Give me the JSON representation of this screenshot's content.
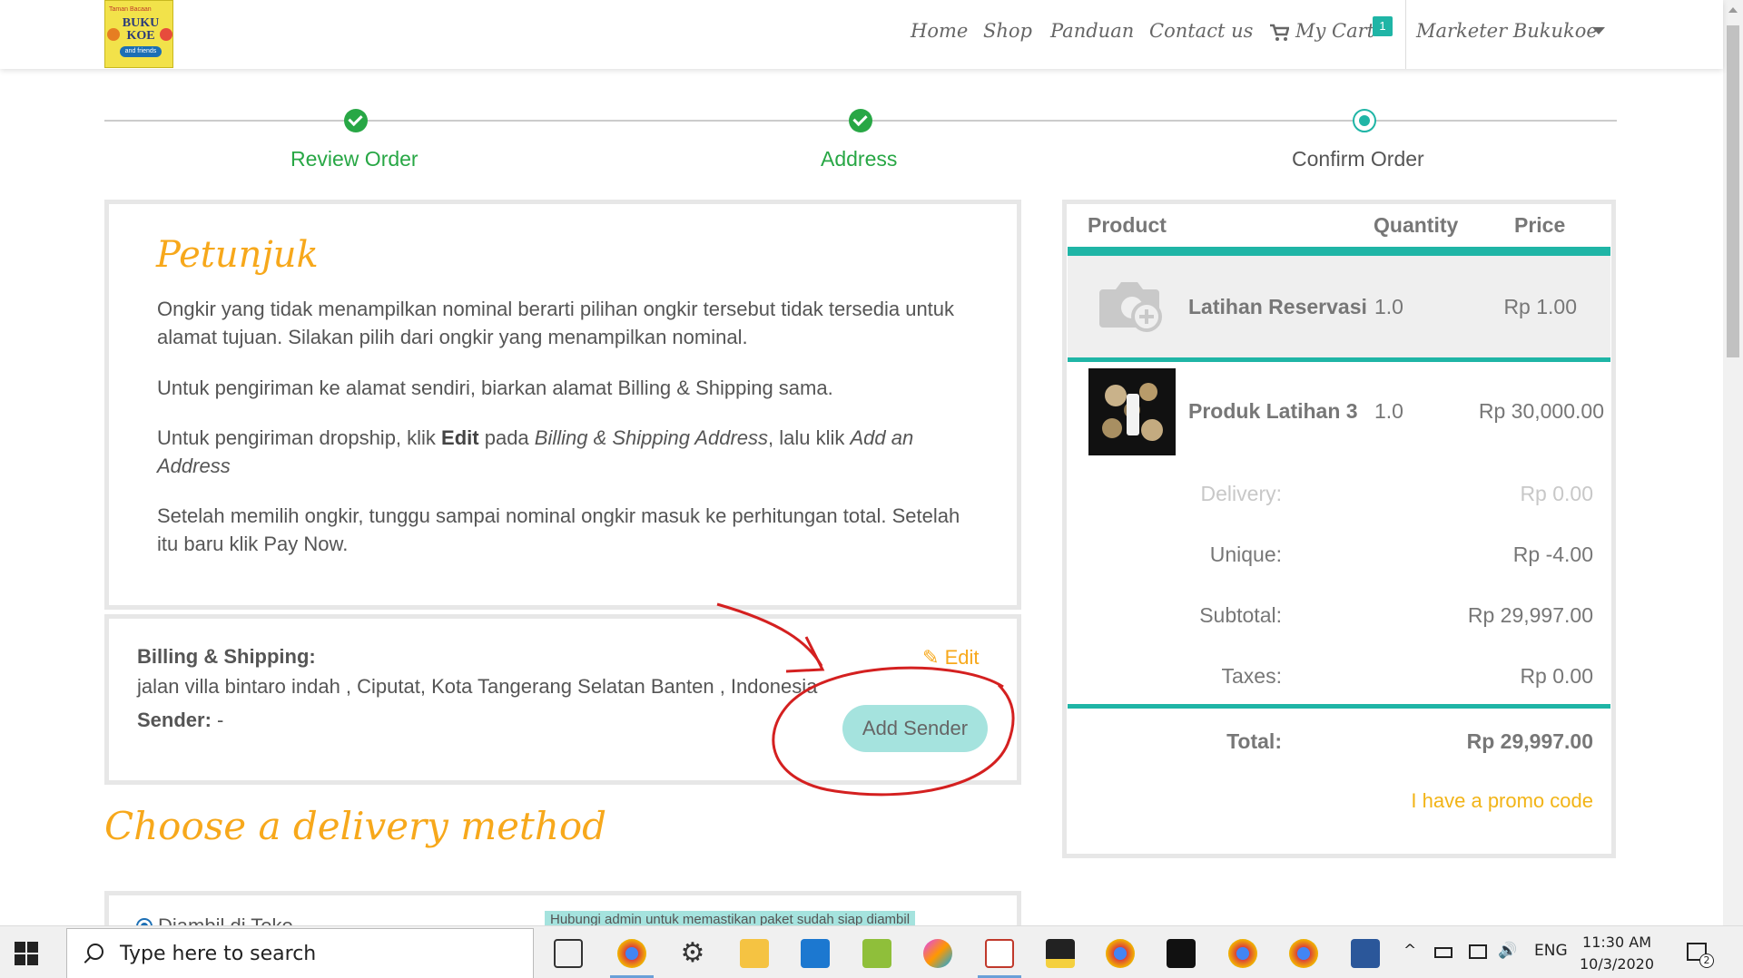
{
  "navbar": {
    "logo": {
      "tagline": "Taman Bacaan",
      "name_line1": "BUKU",
      "name_line2": "KOE",
      "ribbon": "and friends"
    },
    "items": [
      "Home",
      "Shop",
      "Panduan",
      "Contact us"
    ],
    "cart_label": "My Cart",
    "cart_count": "1",
    "user": "Marketer Bukukoe"
  },
  "steps": [
    {
      "label": "Review Order",
      "state": "done"
    },
    {
      "label": "Address",
      "state": "done"
    },
    {
      "label": "Confirm Order",
      "state": "current"
    }
  ],
  "petunjuk": {
    "title": "Petunjuk",
    "p1": "Ongkir yang tidak menampilkan nominal berarti pilihan ongkir tersebut tidak tersedia untuk alamat tujuan. Silakan pilih dari ongkir yang menampilkan nominal.",
    "p2": "Untuk pengiriman ke alamat sendiri, biarkan alamat Billing & Shipping sama.",
    "p3_a": "Untuk pengiriman dropship, klik ",
    "p3_b": "Edit",
    "p3_c": " pada ",
    "p3_d": "Billing & Shipping Address",
    "p3_e": ", lalu klik ",
    "p3_f": "Add an Address",
    "p4": "Setelah memilih ongkir, tunggu sampai nominal ongkir masuk ke perhitungan total. Setelah itu baru klik Pay Now."
  },
  "billing": {
    "label": "Billing & Shipping:",
    "address": "jalan villa bintaro indah , Ciputat, Kota Tangerang Selatan Banten , Indonesia",
    "sender_label": "Sender:",
    "sender_value": " -",
    "edit_label": "Edit",
    "add_sender_label": "Add Sender"
  },
  "delivery": {
    "title": "Choose a delivery method",
    "option_name": "Diambil di Toko",
    "note": "Hubungi admin untuk memastikan paket sudah siap diambil"
  },
  "order": {
    "headers": {
      "product": "Product",
      "quantity": "Quantity",
      "price": "Price"
    },
    "items": [
      {
        "name": "Latihan Reservasi",
        "qty": "1.0",
        "price": "Rp 1.00"
      },
      {
        "name": "Produk Latihan 3",
        "qty": "1.0",
        "price": "Rp 30,000.00"
      }
    ],
    "delivery_label": "Delivery:",
    "delivery_value": "Rp 0.00",
    "unique_label": "Unique:",
    "unique_value": "Rp -4.00",
    "subtotal_label": "Subtotal:",
    "subtotal_value": "Rp 29,997.00",
    "taxes_label": "Taxes:",
    "taxes_value": "Rp 0.00",
    "total_label": "Total:",
    "total_value": "Rp 29,997.00",
    "promo": "I have a promo code"
  },
  "taskbar": {
    "search_placeholder": "Type here to search",
    "lang": "ENG",
    "time": "11:30 AM",
    "date": "10/3/2020",
    "notifications": "2"
  },
  "colors": {
    "accent": "#1fb5a6",
    "success": "#28a745",
    "orange": "#f7a81b",
    "annotation": "#d42020"
  }
}
